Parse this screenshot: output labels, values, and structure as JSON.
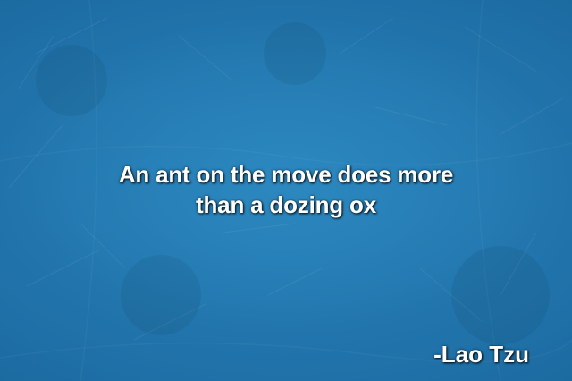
{
  "quote": {
    "lines": [
      "An ant on the move does more",
      "than a dozing ox"
    ]
  },
  "author": "-Lao Tzu",
  "colors": {
    "background": "#1e6fa6",
    "text": "#ffffff"
  }
}
